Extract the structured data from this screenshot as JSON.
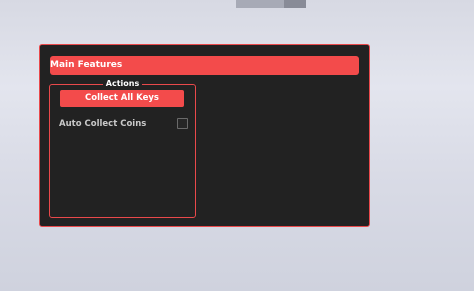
{
  "window": {
    "title": "Main Features"
  },
  "actions_group": {
    "title": "Actions",
    "collect_button_label": "Collect All Keys",
    "toggle": {
      "label": "Auto Collect Coins",
      "checked": false
    }
  },
  "colors": {
    "accent": "#f34b4b",
    "panel_bg": "#222222",
    "border": "#e9494b"
  }
}
